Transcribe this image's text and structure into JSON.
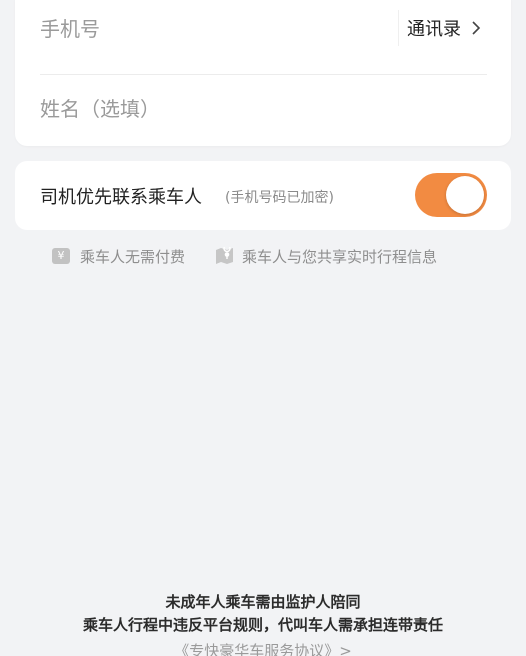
{
  "form": {
    "phone_placeholder": "手机号",
    "contacts_label": "通讯录",
    "name_placeholder": "姓名（选填）"
  },
  "contact_option": {
    "label": "司机优先联系乘车人",
    "note": "(手机号码已加密)",
    "toggle_on": true,
    "toggle_color": "#f28b42"
  },
  "info": {
    "items": [
      {
        "icon": "yen-icon",
        "text": "乘车人无需付费"
      },
      {
        "icon": "map-share-icon",
        "text": "乘车人与您共享实时行程信息"
      }
    ]
  },
  "footer": {
    "notice_line1": "未成年人乘车需由监护人陪同",
    "notice_line2": "乘车人行程中违反平台规则，代叫车人需承担连带责任",
    "agreement_link": "《专快豪华车服务协议》>"
  }
}
